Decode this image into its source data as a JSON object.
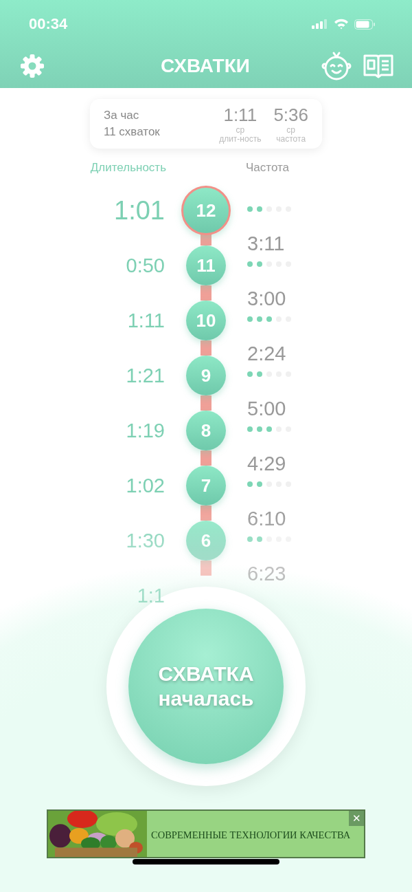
{
  "status_bar": {
    "time": "00:34"
  },
  "header": {
    "title": "СХВАТКИ"
  },
  "summary": {
    "period": "За час",
    "count": "11 схваток",
    "stats": [
      {
        "value": "1:11",
        "unit": "ср",
        "label": "длит-ность"
      },
      {
        "value": "5:36",
        "unit": "ср",
        "label": "частота"
      }
    ]
  },
  "columns": {
    "duration": "Длительность",
    "frequency": "Частота"
  },
  "contractions": [
    {
      "number": "12",
      "duration": "1:01",
      "selected": true,
      "level": 0.4,
      "frequency": "3:11"
    },
    {
      "number": "11",
      "duration": "0:50",
      "selected": false,
      "level": 0.4,
      "frequency": "3:00"
    },
    {
      "number": "10",
      "duration": "1:11",
      "selected": false,
      "level": 0.6,
      "frequency": "2:24"
    },
    {
      "number": "9",
      "duration": "1:21",
      "selected": false,
      "level": 0.4,
      "frequency": "5:00"
    },
    {
      "number": "8",
      "duration": "1:19",
      "selected": false,
      "level": 0.6,
      "frequency": "4:29"
    },
    {
      "number": "7",
      "duration": "1:02",
      "selected": false,
      "level": 0.4,
      "frequency": "6:10"
    },
    {
      "number": "6",
      "duration": "1:30",
      "selected": false,
      "level": 0.4,
      "frequency": "6:23"
    },
    {
      "duration": "1:1",
      "selected": false
    }
  ],
  "start_button": {
    "label": "СХВАТКА началась"
  },
  "ad": {
    "kind": "picture",
    "text": "СОВРЕМЕННЫЕ ТЕХНОЛОГИИ КАЧЕСТВА",
    "close": "✕"
  }
}
